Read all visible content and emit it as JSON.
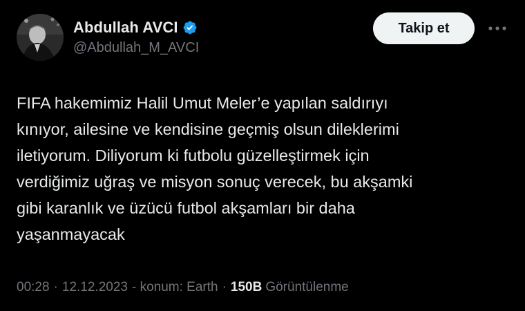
{
  "author": {
    "display_name": "Abdullah AVCI",
    "handle": "@Abdullah_M_AVCI",
    "verified": true,
    "avatar_icon": "user-avatar-photo"
  },
  "actions": {
    "follow_label": "Takip et",
    "more_icon": "more-horizontal-icon"
  },
  "tweet": {
    "text": "FIFA hakemimiz Halil Umut Meler’e yapılan saldırıyı\nkınıyor, ailesine ve kendisine geçmiş olsun dileklerimi\niletiyorum. Diliyorum ki futbolu güzelleştirmek için\nverdiğimiz uğraş ve misyon sonuç verecek, bu akşamki\ngibi karanlık ve üzücü futbol akşamları bir daha\nyaşanmayacak"
  },
  "meta": {
    "time": "00:28",
    "date": "12.12.2023",
    "location": "- konum: Earth",
    "separator": "·",
    "views_count": "150B",
    "views_label": "Görüntülenme"
  },
  "colors": {
    "background": "#000000",
    "text_primary": "#e7e9ea",
    "text_secondary": "#71767b",
    "verified_blue": "#1d9bf0",
    "follow_button_bg": "#eff3f4"
  }
}
